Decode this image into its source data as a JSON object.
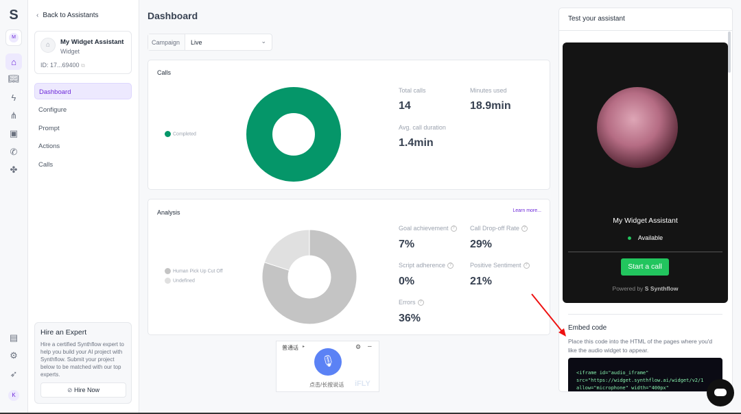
{
  "sidebar": {
    "back": "Back to Assistants",
    "assistant_name": "My Widget Assistant",
    "assistant_type": "Widget",
    "assistant_id": "ID: 17...69400",
    "workspace_initial": "M",
    "user_initial": "K",
    "nav": [
      {
        "label": "Dashboard",
        "active": true
      },
      {
        "label": "Configure"
      },
      {
        "label": "Prompt"
      },
      {
        "label": "Actions"
      },
      {
        "label": "Calls"
      }
    ],
    "hire": {
      "title": "Hire an Expert",
      "text": "Hire a certified Synthflow expert to help you build your AI project with Synthflow. Submit your project below to be matched with our top experts.",
      "button": "Hire Now"
    }
  },
  "main": {
    "title": "Dashboard",
    "campaign_label": "Campaign",
    "campaign_value": "Live",
    "calls": {
      "title": "Calls",
      "stats": [
        {
          "label": "Total calls",
          "value": "14"
        },
        {
          "label": "Minutes used",
          "value": "18.9min"
        },
        {
          "label": "Avg. call duration",
          "value": "1.4min"
        }
      ]
    },
    "analysis": {
      "title": "Analysis",
      "learn_more": "Learn more...",
      "stats": [
        {
          "label": "Goal achievement",
          "value": "7%"
        },
        {
          "label": "Call Drop-off Rate",
          "value": "29%"
        },
        {
          "label": "Script adherence",
          "value": "0%"
        },
        {
          "label": "Positive Sentiment",
          "value": "21%"
        },
        {
          "label": "Errors",
          "value": "36%"
        }
      ]
    }
  },
  "chart_data": [
    {
      "type": "pie",
      "title": "Calls",
      "categories": [
        "Completed"
      ],
      "values": [
        100
      ],
      "colors": [
        "#059669"
      ],
      "legend": "left"
    },
    {
      "type": "pie",
      "title": "Analysis",
      "categories": [
        "Human Pick Up Cut Off",
        "Undefined"
      ],
      "values": [
        80,
        20
      ],
      "colors": [
        "#c4c4c4",
        "#e0e0e0"
      ],
      "legend": "left"
    }
  ],
  "test": {
    "title": "Test your assistant",
    "name": "My Widget Assistant",
    "status": "Available",
    "start": "Start a call",
    "powered": "Powered by",
    "brand": "Synthflow",
    "embed_title": "Embed code",
    "embed_desc": "Place this code into the HTML of the pages where you'd like the audio widget to appear.",
    "code": [
      "<iframe id=\"audio_iframe\"",
      "src=\"https://widget.synthflow.ai/widget/v2/1",
      "allow=\"microphone\" width=\"400px\""
    ]
  },
  "voice_widget": {
    "lang": "普通话",
    "hint": "点击/长按说话",
    "brand": "iFLY"
  },
  "colors": {
    "accent": "#6d28d9",
    "green": "#059669",
    "start": "#22c55e"
  }
}
